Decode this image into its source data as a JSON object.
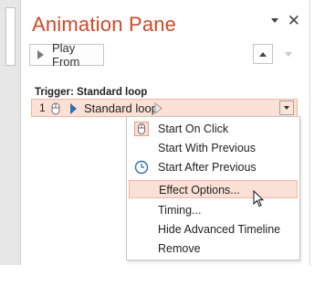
{
  "pane": {
    "title": "Animation Pane",
    "play_from_label": "Play From"
  },
  "trigger": {
    "heading": "Trigger: Standard loop",
    "row": {
      "number": "1",
      "label": "Standard loop"
    }
  },
  "context_menu": {
    "items": [
      {
        "label": "Start On Click",
        "icon": "mouse-click-icon",
        "state": "checked"
      },
      {
        "label": "Start With Previous",
        "icon": ""
      },
      {
        "label": "Start After Previous",
        "icon": "clock-icon"
      },
      {
        "label": "Effect Options...",
        "icon": "",
        "state": "highlighted"
      },
      {
        "label": "Timing...",
        "icon": ""
      },
      {
        "label": "Hide Advanced Timeline",
        "icon": ""
      },
      {
        "label": "Remove",
        "icon": ""
      }
    ]
  },
  "colors": {
    "title": "#d24726",
    "highlight_fill": "#fbe0d5",
    "highlight_border": "#f2b7a0",
    "effect_icon": "#2e6db4"
  }
}
